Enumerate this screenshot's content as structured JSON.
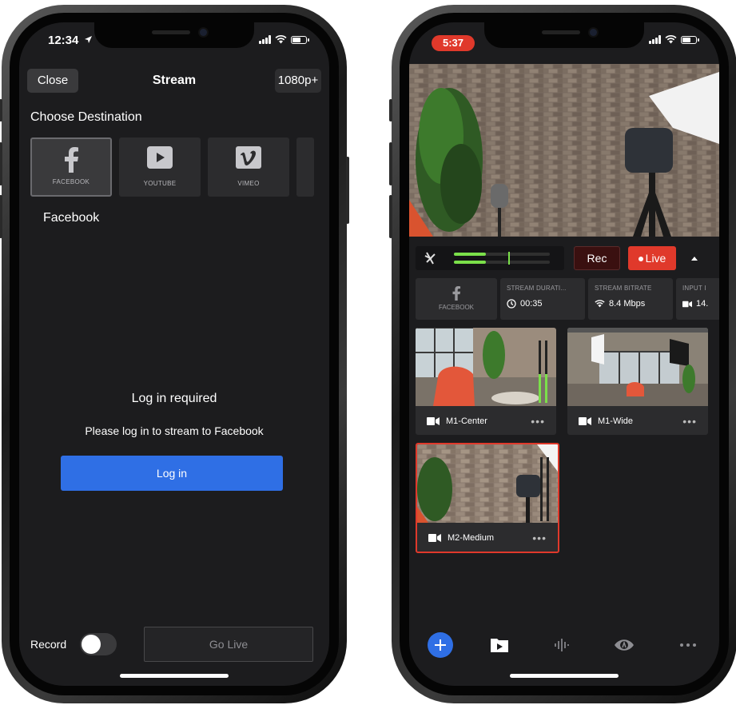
{
  "left_phone": {
    "status_time": "12:34",
    "nav": {
      "close_label": "Close",
      "title": "Stream",
      "resolution": "1080p+"
    },
    "choose_destination": "Choose Destination",
    "destinations": [
      {
        "label": "FACEBOOK",
        "icon": "facebook-icon",
        "selected": true
      },
      {
        "label": "YOUTUBE",
        "icon": "youtube-icon",
        "selected": false
      },
      {
        "label": "VIMEO",
        "icon": "vimeo-icon",
        "selected": false
      }
    ],
    "selected_destination_name": "Facebook",
    "login_heading": "Log in required",
    "login_message": "Please log in to stream to Facebook",
    "login_button": "Log in",
    "record_label": "Record",
    "record_enabled": false,
    "go_live_button": "Go Live",
    "accent_color": "#2f6fe5"
  },
  "right_phone": {
    "status_time": "5:37",
    "controls": {
      "rec_label": "Rec",
      "live_label": "Live",
      "live_color": "#e0392b"
    },
    "stats": {
      "destination_label": "FACEBOOK",
      "duration_label": "STREAM DURATI...",
      "duration_value": "00:35",
      "bitrate_label": "STREAM BITRATE",
      "bitrate_value": "8.4 Mbps",
      "input_label": "INPUT I",
      "input_value": "14."
    },
    "cameras": [
      {
        "name": "M1-Center",
        "selected": false
      },
      {
        "name": "M1-Wide",
        "selected": false
      },
      {
        "name": "M2-Medium",
        "selected": true
      }
    ],
    "more_label": "•••",
    "tabbar_icons": [
      "add-icon",
      "media-icon",
      "audio-icon",
      "overlay-icon",
      "more-icon"
    ]
  }
}
